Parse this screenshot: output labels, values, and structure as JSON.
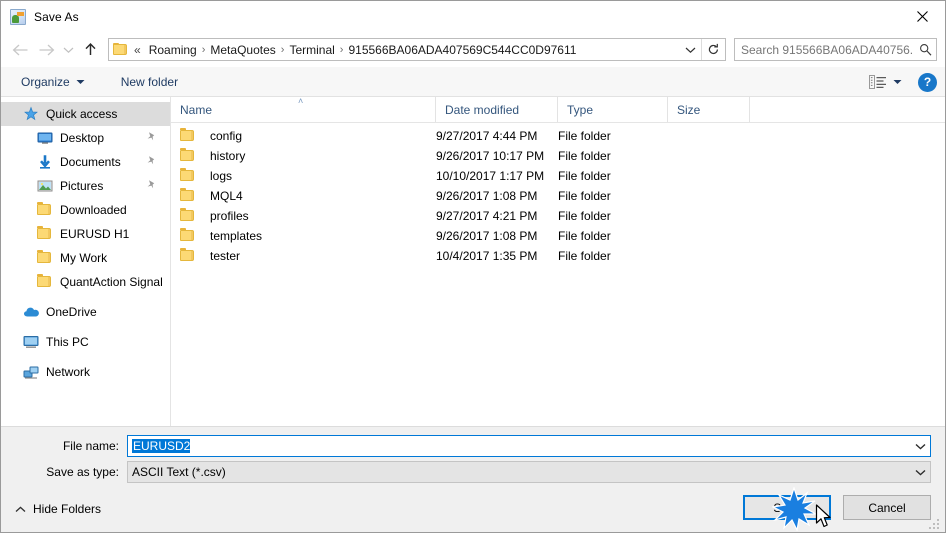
{
  "window": {
    "title": "Save As",
    "title_icon": "app-icon",
    "close_label": "✕"
  },
  "nav": {
    "back_icon": "arrow-left-icon",
    "forward_icon": "arrow-right-icon",
    "recent_icon": "chevron-down-icon",
    "up_icon": "arrow-up-icon",
    "address": {
      "folder_icon": "folder-icon",
      "prefix": "«",
      "crumbs": [
        "Roaming",
        "MetaQuotes",
        "Terminal",
        "915566BA06ADA407569C544CC0D97611"
      ],
      "separator": "›",
      "dropdown_icon": "chevron-down-icon",
      "refresh_icon": "refresh-icon"
    },
    "search": {
      "placeholder": "Search 915566BA06ADA40756...",
      "icon": "search-icon"
    }
  },
  "commandbar": {
    "organize_label": "Organize",
    "organize_caret": "▾",
    "new_folder_label": "New folder",
    "view_icon": "view-options-icon",
    "view_caret": "▾",
    "help_label": "?"
  },
  "sidebar": {
    "items": [
      {
        "label": "Quick access",
        "icon": "star-icon",
        "selected": true,
        "indent": false,
        "pinned": false,
        "group": false
      },
      {
        "label": "Desktop",
        "icon": "desktop-icon",
        "selected": false,
        "indent": true,
        "pinned": true,
        "group": false
      },
      {
        "label": "Documents",
        "icon": "documents-icon",
        "selected": false,
        "indent": true,
        "pinned": true,
        "group": false
      },
      {
        "label": "Pictures",
        "icon": "pictures-icon",
        "selected": false,
        "indent": true,
        "pinned": true,
        "group": false
      },
      {
        "label": "Downloaded",
        "icon": "folder-icon",
        "selected": false,
        "indent": true,
        "pinned": false,
        "group": false
      },
      {
        "label": "EURUSD H1",
        "icon": "folder-icon",
        "selected": false,
        "indent": true,
        "pinned": false,
        "group": false
      },
      {
        "label": "My Work",
        "icon": "folder-icon",
        "selected": false,
        "indent": true,
        "pinned": false,
        "group": false
      },
      {
        "label": "QuantAction Signal",
        "icon": "folder-icon",
        "selected": false,
        "indent": true,
        "pinned": false,
        "group": false
      },
      {
        "label": "OneDrive",
        "icon": "onedrive-icon",
        "selected": false,
        "indent": false,
        "pinned": false,
        "group": true
      },
      {
        "label": "This PC",
        "icon": "this-pc-icon",
        "selected": false,
        "indent": false,
        "pinned": false,
        "group": true
      },
      {
        "label": "Network",
        "icon": "network-icon",
        "selected": false,
        "indent": false,
        "pinned": false,
        "group": true
      }
    ],
    "pin_glyph": "📌"
  },
  "filelist": {
    "columns": [
      "Name",
      "Date modified",
      "Type",
      "Size"
    ],
    "sort_caret": "˄",
    "rows": [
      {
        "name": "config",
        "date": "9/27/2017 4:44 PM",
        "type": "File folder",
        "size": ""
      },
      {
        "name": "history",
        "date": "9/26/2017 10:17 PM",
        "type": "File folder",
        "size": ""
      },
      {
        "name": "logs",
        "date": "10/10/2017 1:17 PM",
        "type": "File folder",
        "size": ""
      },
      {
        "name": "MQL4",
        "date": "9/26/2017 1:08 PM",
        "type": "File folder",
        "size": ""
      },
      {
        "name": "profiles",
        "date": "9/27/2017 4:21 PM",
        "type": "File folder",
        "size": ""
      },
      {
        "name": "templates",
        "date": "9/26/2017 1:08 PM",
        "type": "File folder",
        "size": ""
      },
      {
        "name": "tester",
        "date": "10/4/2017 1:35 PM",
        "type": "File folder",
        "size": ""
      }
    ]
  },
  "form": {
    "filename_label": "File name:",
    "filename_value": "EURUSD2",
    "filename_caret": "⌄",
    "filetype_label": "Save as type:",
    "filetype_value": "ASCII Text (*.csv)",
    "filetype_caret": "⌄"
  },
  "footer": {
    "hide_folders_label": "Hide Folders",
    "hide_folders_caret": "˄",
    "save_label": "Save",
    "cancel_label": "Cancel"
  },
  "colors": {
    "accent": "#0078d7",
    "folder": "#fcd975",
    "header_text": "#34567d",
    "help_blue": "#1877c9"
  }
}
